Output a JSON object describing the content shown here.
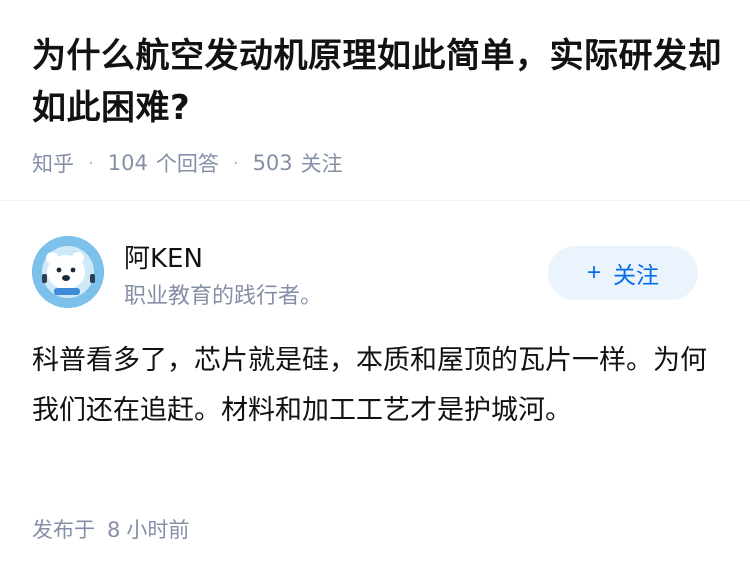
{
  "question": {
    "title": "为什么航空发动机原理如此简单，实际研发却如此困难?",
    "source": "知乎",
    "answer_count": "104",
    "answer_label": "个回答",
    "follower_count": "503",
    "follower_label": "关注"
  },
  "author": {
    "name": "阿KEN",
    "bio": "职业教育的践行者。",
    "avatar_icon": "polar-bear-avatar"
  },
  "follow_button": {
    "icon": "+",
    "label": "关注"
  },
  "answer": {
    "text": "科普看多了，芯片就是硅，本质和屋顶的瓦片一样。为何我们还在追赶。材料和加工工艺才是护城河。"
  },
  "footer": {
    "prefix": "发布于",
    "hours": "8",
    "suffix": "小时前"
  },
  "colors": {
    "accent": "#056de8",
    "accent_bg": "#ebf3fc",
    "meta": "#8590a6"
  }
}
